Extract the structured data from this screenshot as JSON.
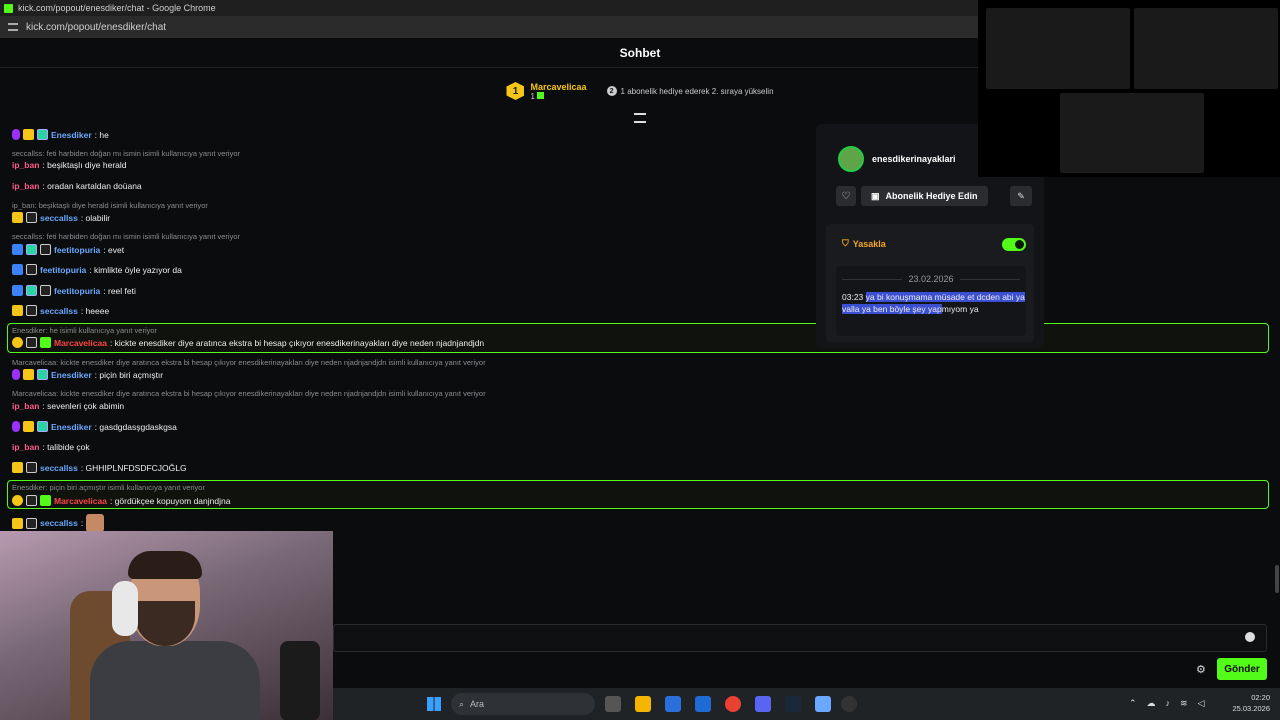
{
  "window": {
    "title": "kick.com/popout/enesdiker/chat - Google Chrome",
    "url": "kick.com/popout/enesdiker/chat"
  },
  "chat": {
    "header": "Sohbet",
    "pinned": {
      "rank": "1",
      "name": "Marcavelicaa",
      "count": "1",
      "hint_num": "2",
      "hint": "1 abonelik hediye ederek 2. sıraya yükselin"
    },
    "messages": [
      {
        "type": "msg",
        "user": "Enesdiker",
        "text": ": he"
      },
      {
        "type": "reply",
        "text": "seccallss: feti harbiden doğan mı ismin isimli kullanıcıya yanıt veriyor"
      },
      {
        "type": "msg",
        "user": "ip_ban",
        "text": ": beşiktaşlı diye herald"
      },
      {
        "type": "msg",
        "user": "ip_ban",
        "text": ": oradan kartaldan doüana"
      },
      {
        "type": "reply",
        "text": "ip_ban: beşiktaşlı diye herald isimli kullanıcıya yanıt veriyor"
      },
      {
        "type": "msg",
        "user": "seccallss",
        "text": ": olabilir"
      },
      {
        "type": "reply",
        "text": "seccallss: feti harbiden doğan mı ismin isimli kullanıcıya yanıt veriyor"
      },
      {
        "type": "msg",
        "user": "feetitopuria",
        "text": ": evet"
      },
      {
        "type": "msg",
        "user": "feetitopuria",
        "text": ": kimlikte öyle yazıyor da"
      },
      {
        "type": "msg",
        "user": "feetitopuria",
        "text": ": reel feti"
      },
      {
        "type": "msg",
        "user": "seccallss",
        "text": ": heeee"
      },
      {
        "type": "reply",
        "text": "Enesdiker: he isimli kullanıcıya yanıt veriyor"
      },
      {
        "type": "msg",
        "user": "Marcavelicaa",
        "text": ": kickte enesdiker diye aratınca ekstra bi hesap çıkıyor enesdikerinayakları diye neden njadnjandjdn"
      },
      {
        "type": "reply",
        "text": "Marcavelicaa: kickte enesdiker diye aratınca ekstra bi hesap çıkıyor enesdikerinayakları diye neden njadnjandjdn isimli kullanıcıya yanıt veriyor"
      },
      {
        "type": "msg",
        "user": "Enesdiker",
        "text": ": piçin biri açmıştır"
      },
      {
        "type": "reply",
        "text": "Marcavelicaa: kickte enesdiker diye aratınca ekstra bi hesap çıkıyor enesdikerinayakları diye neden njadnjandjdn isimli kullanıcıya yanıt veriyor"
      },
      {
        "type": "msg",
        "user": "ip_ban",
        "text": ": sevenleri çok abimin"
      },
      {
        "type": "msg",
        "user": "Enesdiker",
        "text": ": gasdgdasşgdaskgsa"
      },
      {
        "type": "msg",
        "user": "ip_ban",
        "text": ": talibide çok"
      },
      {
        "type": "msg",
        "user": "seccallss",
        "text": ": GHHIPLNFDSDFCJOĞLG"
      },
      {
        "type": "reply",
        "text": "Enesdiker: piçin biri açmıştır isimli kullanıcıya yanıt veriyor"
      },
      {
        "type": "msg",
        "user": "Marcavelicaa",
        "text": ": gördükçee kopuyom danjndjna"
      },
      {
        "type": "msg",
        "user": "seccallss",
        "text": ":"
      }
    ]
  },
  "user_card": {
    "username": "enesdikerinayaklari",
    "gift_label": "Abonelik Hediye Edin",
    "ban_label": "Yasakla",
    "history_date": "23.02.2026",
    "history_time": "03:23",
    "history_sel": "ya bi konuşmama müsade et dcden abi ya valla ya ben böyle şey yap",
    "history_rest": "mıyom ya"
  },
  "input": {
    "send_label": "Gönder"
  },
  "taskbar": {
    "search_placeholder": "Ara",
    "time": "02:20",
    "date": "25.03.2026"
  },
  "colors": {
    "accent": "#53fc18",
    "background": "#0b0c0e"
  }
}
